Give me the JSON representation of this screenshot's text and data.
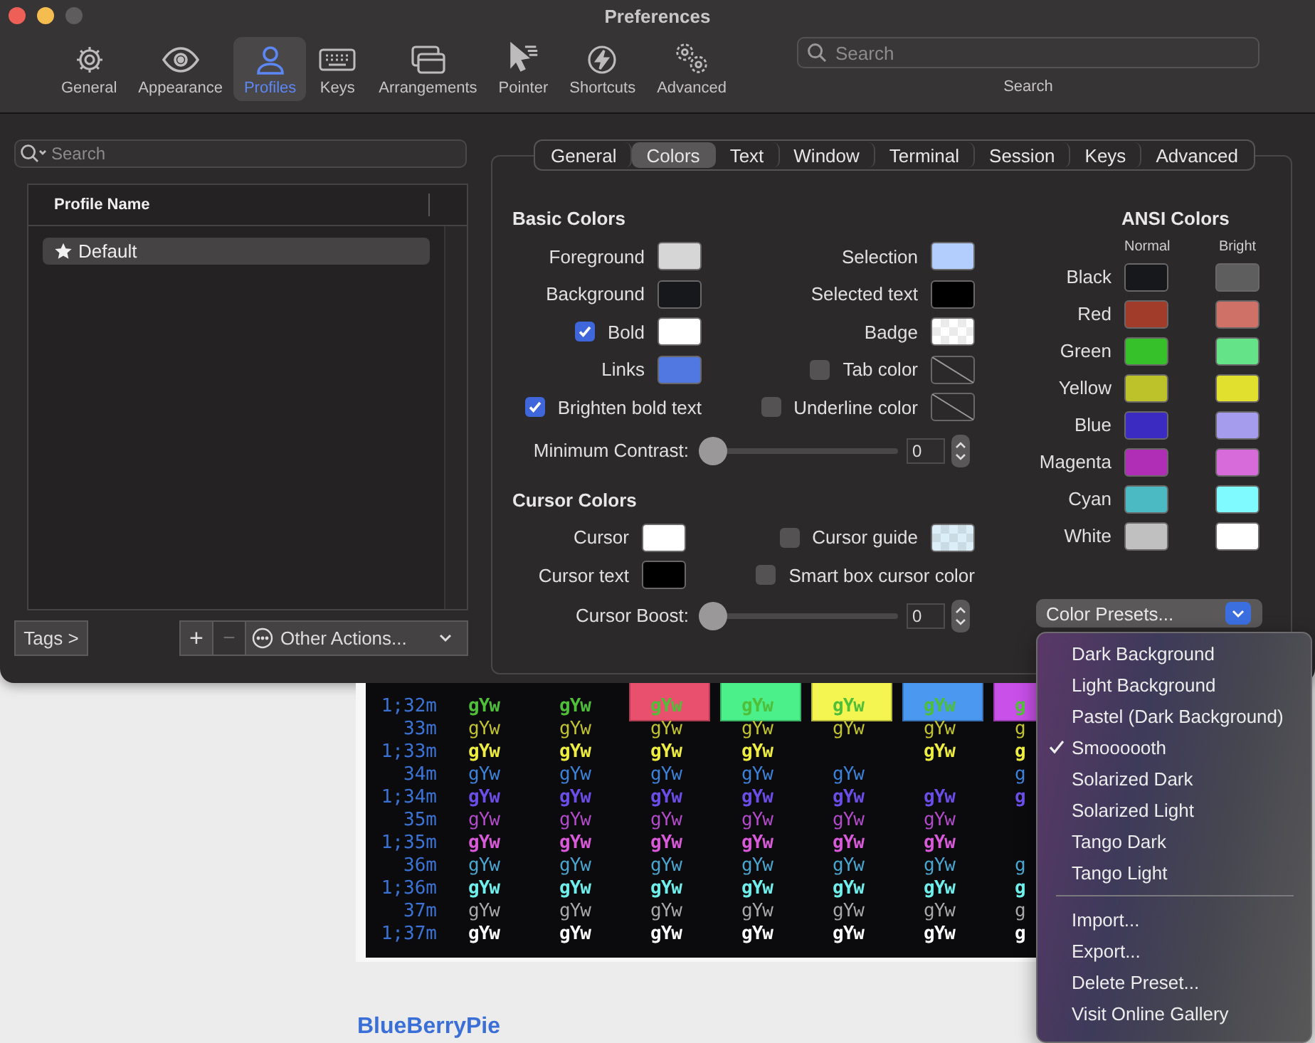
{
  "window": {
    "title": "Preferences"
  },
  "toolbar": {
    "items": [
      {
        "label": "General",
        "kind": "gear",
        "selected": false
      },
      {
        "label": "Appearance",
        "kind": "eye",
        "selected": false
      },
      {
        "label": "Profiles",
        "kind": "person",
        "selected": true
      },
      {
        "label": "Keys",
        "kind": "keyboard",
        "selected": false
      },
      {
        "label": "Arrangements",
        "kind": "windows",
        "selected": false
      },
      {
        "label": "Pointer",
        "kind": "pointer",
        "selected": false
      },
      {
        "label": "Shortcuts",
        "kind": "bolt",
        "selected": false
      },
      {
        "label": "Advanced",
        "kind": "gears",
        "selected": false
      }
    ],
    "search": {
      "placeholder": "Search",
      "label": "Search"
    }
  },
  "profiles": {
    "search": {
      "placeholder": "Search"
    },
    "column": "Profile Name",
    "rows": [
      {
        "name": "Default",
        "default": true,
        "selected": true
      }
    ],
    "tags_button": "Tags >",
    "add_button": "+",
    "remove_button": {
      "label": "−",
      "disabled": true
    },
    "actions_button": "Other Actions..."
  },
  "tabs": [
    {
      "label": "General",
      "selected": false
    },
    {
      "label": "Colors",
      "selected": true
    },
    {
      "label": "Text",
      "selected": false
    },
    {
      "label": "Window",
      "selected": false
    },
    {
      "label": "Terminal",
      "selected": false
    },
    {
      "label": "Session",
      "selected": false
    },
    {
      "label": "Keys",
      "selected": false
    },
    {
      "label": "Advanced",
      "selected": false
    }
  ],
  "basic_colors": {
    "title": "Basic Colors",
    "rows": [
      {
        "left": {
          "kind": "swatch",
          "label": "Foreground",
          "well": {
            "kind": "solid",
            "color": "#d6d6d6"
          }
        },
        "right": {
          "kind": "swatch",
          "label": "Selection",
          "well": {
            "kind": "solid",
            "color": "#b3cdfd"
          }
        }
      },
      {
        "left": {
          "kind": "swatch",
          "label": "Background",
          "well": {
            "kind": "solid",
            "color": "#17181c"
          }
        },
        "right": {
          "kind": "swatch",
          "label": "Selected text",
          "well": {
            "kind": "solid",
            "color": "#000000"
          }
        }
      },
      {
        "left": {
          "kind": "check-swatch",
          "label": "Bold",
          "checked": true,
          "well": {
            "kind": "solid",
            "color": "#ffffff"
          }
        },
        "right": {
          "kind": "swatch",
          "label": "Badge",
          "well": {
            "kind": "checker",
            "color": "#ffffff"
          }
        }
      },
      {
        "left": {
          "kind": "swatch",
          "label": "Links",
          "well": {
            "kind": "solid",
            "color": "#5078e0"
          }
        },
        "right": {
          "kind": "check-swatch",
          "label": "Tab color",
          "checked": false,
          "well": {
            "kind": "none"
          }
        }
      },
      {
        "left": {
          "kind": "checkbox",
          "label": "Brighten bold text",
          "checked": true
        },
        "right": {
          "kind": "check-swatch",
          "label": "Underline color",
          "checked": false,
          "well": {
            "kind": "none"
          }
        }
      }
    ],
    "slider": {
      "label": "Minimum Contrast:",
      "level": 0,
      "value": "0"
    }
  },
  "cursor_colors": {
    "title": "Cursor Colors",
    "rows": [
      {
        "left": {
          "kind": "swatch",
          "label": "Cursor",
          "well": {
            "kind": "solid",
            "color": "#ffffff"
          }
        },
        "right": {
          "kind": "check-swatch",
          "label": "Cursor guide",
          "checked": false,
          "well": {
            "kind": "checker",
            "color": "#dceef7"
          }
        }
      },
      {
        "left": {
          "kind": "swatch",
          "label": "Cursor text",
          "well": {
            "kind": "solid",
            "color": "#000000"
          }
        },
        "right": {
          "kind": "checkbox",
          "label": "Smart box cursor color",
          "checked": false
        }
      }
    ],
    "slider": {
      "label": "Cursor Boost:",
      "level": 0,
      "value": "0"
    }
  },
  "ansi_colors": {
    "title": "ANSI Colors",
    "normal_heading": "Normal",
    "bright_heading": "Bright",
    "rows": [
      {
        "name": "Black",
        "normal": {
          "color": "#16181c"
        },
        "bright": {
          "color": "#5e5e5e"
        }
      },
      {
        "name": "Red",
        "normal": {
          "color": "#a23c2a"
        },
        "bright": {
          "color": "#cf7166"
        }
      },
      {
        "name": "Green",
        "normal": {
          "color": "#36c12a"
        },
        "bright": {
          "color": "#64e389"
        }
      },
      {
        "name": "Yellow",
        "normal": {
          "color": "#bdc22a"
        },
        "bright": {
          "color": "#e2e02f"
        }
      },
      {
        "name": "Blue",
        "normal": {
          "color": "#3c2bc0"
        },
        "bright": {
          "color": "#a59ced"
        }
      },
      {
        "name": "Magenta",
        "normal": {
          "color": "#b02eb5"
        },
        "bright": {
          "color": "#d66bd9"
        }
      },
      {
        "name": "Cyan",
        "normal": {
          "color": "#4bbac3"
        },
        "bright": {
          "color": "#7ffaff"
        }
      },
      {
        "name": "White",
        "normal": {
          "color": "#c0c0c0"
        },
        "bright": {
          "color": "#ffffff"
        }
      }
    ]
  },
  "color_presets": {
    "label": "Color Presets...",
    "menu": {
      "presets": [
        {
          "label": "Dark Background",
          "selected": false
        },
        {
          "label": "Light Background",
          "selected": false
        },
        {
          "label": "Pastel (Dark Background)",
          "selected": false
        },
        {
          "label": "Smoooooth",
          "selected": true
        },
        {
          "label": "Solarized Dark",
          "selected": false
        },
        {
          "label": "Solarized Light",
          "selected": false
        },
        {
          "label": "Tango Dark",
          "selected": false
        },
        {
          "label": "Tango Light",
          "selected": false
        }
      ],
      "actions": [
        "Import...",
        "Export...",
        "Delete Preset...",
        "Visit Online Gallery"
      ]
    }
  },
  "terminal_sample": {
    "columns": [
      {
        "kind": "plain"
      },
      {
        "kind": "plain"
      },
      {
        "kind": "band",
        "color": "#e8506e"
      },
      {
        "kind": "band",
        "color": "#4cf08a"
      },
      {
        "kind": "band",
        "color": "#f5f552"
      },
      {
        "kind": "band",
        "color": "#4a98f0"
      },
      {
        "kind": "band",
        "color": "#c950e9"
      }
    ],
    "rows": [
      {
        "code": "1;32m",
        "bold": true,
        "color": "#4fbf3a",
        "cells": [
          "gYw",
          "gYw",
          "gYw",
          "gYw",
          "gYw",
          "gYw",
          "g"
        ]
      },
      {
        "code": "33m",
        "bold": false,
        "color": "#c2c22e",
        "cells": [
          "gYw",
          "gYw",
          "gYw",
          "gYw",
          "gYw",
          "gYw",
          "g"
        ]
      },
      {
        "code": "1;33m",
        "bold": true,
        "color": "#eeee40",
        "cells": [
          "gYw",
          "gYw",
          "gYw",
          "gYw",
          null,
          "gYw",
          "g"
        ]
      },
      {
        "code": "34m",
        "bold": false,
        "color": "#3d82d8",
        "cells": [
          "gYw",
          "gYw",
          "gYw",
          "gYw",
          "gYw",
          null,
          "g"
        ]
      },
      {
        "code": "1;34m",
        "bold": true,
        "color": "#6b4de8",
        "cells": [
          "gYw",
          "gYw",
          "gYw",
          "gYw",
          "gYw",
          "gYw",
          "g"
        ]
      },
      {
        "code": "35m",
        "bold": false,
        "color": "#b04cc8",
        "cells": [
          "gYw",
          "gYw",
          "gYw",
          "gYw",
          "gYw",
          "gYw",
          null
        ]
      },
      {
        "code": "1;35m",
        "bold": true,
        "color": "#d95ad8",
        "cells": [
          "gYw",
          "gYw",
          "gYw",
          "gYw",
          "gYw",
          "gYw",
          null
        ]
      },
      {
        "code": "36m",
        "bold": false,
        "color": "#4aa6d0",
        "cells": [
          "gYw",
          "gYw",
          "gYw",
          "gYw",
          "gYw",
          "gYw",
          "g"
        ]
      },
      {
        "code": "1;36m",
        "bold": true,
        "color": "#6ff0ec",
        "cells": [
          "gYw",
          "gYw",
          "gYw",
          "gYw",
          "gYw",
          "gYw",
          "g"
        ]
      },
      {
        "code": "37m",
        "bold": false,
        "color": "#a8a8a8",
        "cells": [
          "gYw",
          "gYw",
          "gYw",
          "gYw",
          "gYw",
          "gYw",
          "g"
        ]
      },
      {
        "code": "1;37m",
        "bold": true,
        "color": "#ffffff",
        "cells": [
          "gYw",
          "gYw",
          "gYw",
          "gYw",
          "gYw",
          "gYw",
          "g"
        ]
      }
    ]
  },
  "heading": "BlueBerryPie"
}
